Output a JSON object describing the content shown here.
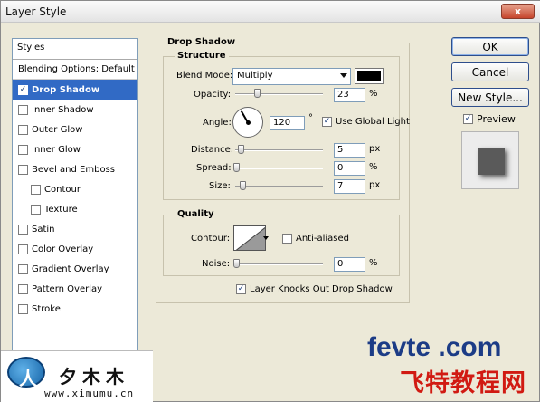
{
  "window": {
    "title": "Layer Style",
    "close_label": "x"
  },
  "sidebar": {
    "header": "Styles",
    "items": [
      {
        "label": "Blending Options: Default",
        "checkbox": false,
        "checked": false,
        "sub": false,
        "selected": false
      },
      {
        "label": "Drop Shadow",
        "checkbox": true,
        "checked": true,
        "sub": false,
        "selected": true
      },
      {
        "label": "Inner Shadow",
        "checkbox": true,
        "checked": false,
        "sub": false,
        "selected": false
      },
      {
        "label": "Outer Glow",
        "checkbox": true,
        "checked": false,
        "sub": false,
        "selected": false
      },
      {
        "label": "Inner Glow",
        "checkbox": true,
        "checked": false,
        "sub": false,
        "selected": false
      },
      {
        "label": "Bevel and Emboss",
        "checkbox": true,
        "checked": false,
        "sub": false,
        "selected": false
      },
      {
        "label": "Contour",
        "checkbox": true,
        "checked": false,
        "sub": true,
        "selected": false
      },
      {
        "label": "Texture",
        "checkbox": true,
        "checked": false,
        "sub": true,
        "selected": false
      },
      {
        "label": "Satin",
        "checkbox": true,
        "checked": false,
        "sub": false,
        "selected": false
      },
      {
        "label": "Color Overlay",
        "checkbox": true,
        "checked": false,
        "sub": false,
        "selected": false
      },
      {
        "label": "Gradient Overlay",
        "checkbox": true,
        "checked": false,
        "sub": false,
        "selected": false
      },
      {
        "label": "Pattern Overlay",
        "checkbox": true,
        "checked": false,
        "sub": false,
        "selected": false
      },
      {
        "label": "Stroke",
        "checkbox": true,
        "checked": false,
        "sub": false,
        "selected": false
      }
    ]
  },
  "drop_shadow": {
    "section_title": "Drop Shadow",
    "structure": {
      "title": "Structure",
      "blend_mode_label": "Blend Mode:",
      "blend_mode_value": "Multiply",
      "shadow_color": "#000000",
      "opacity_label": "Opacity:",
      "opacity_value": "23",
      "opacity_unit": "%",
      "angle_label": "Angle:",
      "angle_value": "120",
      "angle_unit": "°",
      "use_global_light_label": "Use Global Light",
      "use_global_light_checked": true,
      "distance_label": "Distance:",
      "distance_value": "5",
      "distance_unit": "px",
      "spread_label": "Spread:",
      "spread_value": "0",
      "spread_unit": "%",
      "size_label": "Size:",
      "size_value": "7",
      "size_unit": "px"
    },
    "quality": {
      "title": "Quality",
      "contour_label": "Contour:",
      "anti_aliased_label": "Anti-aliased",
      "anti_aliased_checked": false,
      "noise_label": "Noise:",
      "noise_value": "0",
      "noise_unit": "%"
    },
    "layer_knocks_out_label": "Layer Knocks Out Drop Shadow",
    "layer_knocks_out_checked": true
  },
  "buttons": {
    "ok": "OK",
    "cancel": "Cancel",
    "new_style": "New Style..."
  },
  "preview": {
    "label": "Preview",
    "checked": true
  },
  "watermarks": {
    "left_chinese": "夕木木",
    "left_url": "www.ximumu.cn",
    "right_english": "fevte .com",
    "right_chinese": "飞特教程网"
  }
}
